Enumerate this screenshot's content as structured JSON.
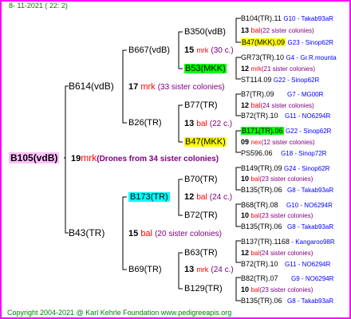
{
  "date": "8- 11-2021 ( 22: 2)",
  "footer": "Copyright 2004-2021 @ Karl Kehrle Foundation    www.pedigreeapis.org",
  "root": {
    "name": "B105(vdB)",
    "count": "19",
    "mrk": "mrk",
    "note": "(Drones from 34 sister colonies)"
  },
  "gen1": [
    {
      "name": "B614(vdB)",
      "count": "17",
      "mrk": "mrk",
      "note": "(33 sister colonies)"
    },
    {
      "name": "B43(TR)",
      "count": "15",
      "mrk": "bal",
      "note": "(20 sister colonies)"
    }
  ],
  "gen2": [
    {
      "name": "B667(vdB)"
    },
    {
      "name": "B26(TR)"
    },
    {
      "name": "B173(TR)",
      "count": "12",
      "mrk": "bal",
      "note": "(24 c.)"
    },
    {
      "name": "B69(TR)",
      "count": "13",
      "mrk": "mrk",
      "note": "(24 c.)"
    }
  ],
  "gen3": [
    {
      "name": "B350(vdB)",
      "count": "15",
      "mrk": "mrk",
      "note": "(30 c.)"
    },
    {
      "name": "B53(MKK)",
      "count": "12",
      "mrk": "mrk",
      "note": "(21 sister colonies)"
    },
    {
      "name": "B77(TR)",
      "count": "13",
      "mrk": "bal",
      "note": "(22 c.)"
    },
    {
      "name": "B47(MKK)",
      "count": "09",
      "mrk": "nex",
      "note": "(12 sister colonies)"
    },
    {
      "name": "B70(TR)",
      "count": "10",
      "mrk": "bal",
      "note": "(23 sister colonies)"
    },
    {
      "name": "B72(TR)",
      "count": "10",
      "mrk": "bal",
      "note": "(23 sister colonies)"
    },
    {
      "name": "B63(TR)",
      "count": "12",
      "mrk": "bal",
      "note": "(24 sister colonies)"
    },
    {
      "name": "B129(TR)",
      "count": "10",
      "mrk": "bal",
      "note": "(23 sister colonies)"
    }
  ],
  "gen4": [
    {
      "name": "B104(TR).11",
      "ref": "G10 - Takab93aR"
    },
    {
      "name": "B47(MKK).09",
      "ref": "G23 - Sinop62R"
    },
    {
      "name": "GR73(TR).10",
      "ref": "G4 - Gr.R.mounta"
    },
    {
      "name": "ST114.09",
      "ref": "G22 - Sinop62R"
    },
    {
      "name": "B7(TR).09",
      "ref": "G7 - MG00R"
    },
    {
      "name": "B72(TR).10",
      "ref": "G11 - NO6294R"
    },
    {
      "name": "B171(TR).06",
      "ref": "G22 - Sinop62R"
    },
    {
      "name": "PS596.06",
      "ref": "G18 - Sinop72R"
    },
    {
      "name": "B149(TR).09",
      "ref": "G24 - Sinop62R"
    },
    {
      "name": "B135(TR).06",
      "ref": "G8 - Takab93aR"
    },
    {
      "name": "B68(TR).08",
      "ref": "G10 - NO6294R"
    },
    {
      "name": "B135(TR).06",
      "ref": "G8 - Takab93aR"
    },
    {
      "name": "B137(TR).1168",
      "ref": "- Kangaroo98R"
    },
    {
      "name": "B72(TR).10",
      "ref": "G11 - NO6294R"
    },
    {
      "name": "B82(TR).07",
      "ref": "G9 - NO6294R"
    },
    {
      "name": "B135(TR).06",
      "ref": "G8 - Takab93aR"
    }
  ]
}
